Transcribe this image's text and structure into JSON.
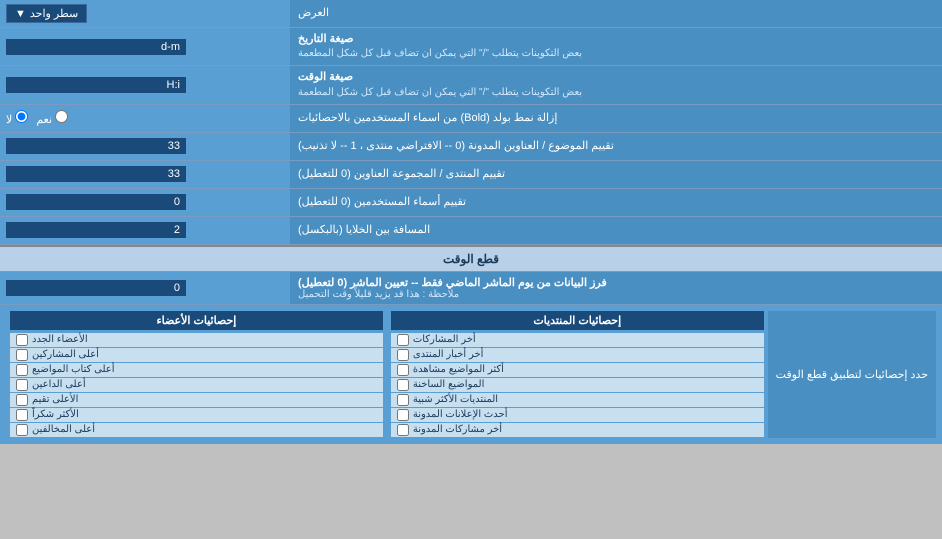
{
  "header": {
    "display_label": "العرض",
    "dropdown_label": "سطر واحد"
  },
  "rows": [
    {
      "id": "date-format",
      "label_line1": "صيغة التاريخ",
      "label_line2": "بعض التكوينات يتطلب \"/\" التي يمكن ان تضاف قبل كل شكل المطعمة",
      "input_value": "d-m",
      "type": "text"
    },
    {
      "id": "time-format",
      "label_line1": "صيغة الوقت",
      "label_line2": "بعض التكوينات يتطلب \"/\" التي يمكن ان تضاف قبل كل شكل المطعمة",
      "input_value": "H:i",
      "type": "text"
    },
    {
      "id": "bold-remove",
      "label": "إزالة نمط بولد (Bold) من اسماء المستخدمين بالاحصائيات",
      "radio_yes": "نعم",
      "radio_no": "لا",
      "selected": "no",
      "type": "radio"
    },
    {
      "id": "topic-sort",
      "label": "تقييم الموضوع / العناوين المدونة (0 -- الافتراضي منتدى ، 1 -- لا تذنيب)",
      "input_value": "33",
      "type": "text"
    },
    {
      "id": "forum-sort",
      "label": "تقييم المنتدى / المجموعة العناوين (0 للتعطيل)",
      "input_value": "33",
      "type": "text"
    },
    {
      "id": "usernames-sort",
      "label": "تقييم أسماء المستخدمين (0 للتعطيل)",
      "input_value": "0",
      "type": "text"
    },
    {
      "id": "gap",
      "label": "المسافة بين الخلايا (بالبكسل)",
      "input_value": "2",
      "type": "text"
    }
  ],
  "cutoff_section": {
    "header": "قطع الوقت",
    "row": {
      "label_line1": "فرز البيانات من يوم الماشر الماضي فقط -- تعيين الماشر (0 لتعطيل)",
      "label_line2": "ملاحظة : هذا قد يزيد قليلاً وقت التحميل",
      "input_value": "0"
    },
    "checkbox_label": "حدد إحصائيات لتطبيق قطع الوقت"
  },
  "stats_section": {
    "col_participations": {
      "header": "إحصائيات المنتديات",
      "items": [
        "أخر المشاركات",
        "أخر أخبار المنتدى",
        "أكثر المواضيع مشاهدة",
        "المواضيع الساخنة",
        "المنتديات الأكثر شبية",
        "أحدث الإعلانات المدونة",
        "أخر مشاركات المدونة"
      ]
    },
    "col_members": {
      "header": "إحصائيات الأعضاء",
      "items": [
        "الأعضاء الجدد",
        "أعلى المشاركين",
        "أعلى كتاب المواضيع",
        "أعلى الداعين",
        "الأعلى تقيم",
        "الأكثر شكراً",
        "أعلى المخالفين"
      ]
    }
  }
}
